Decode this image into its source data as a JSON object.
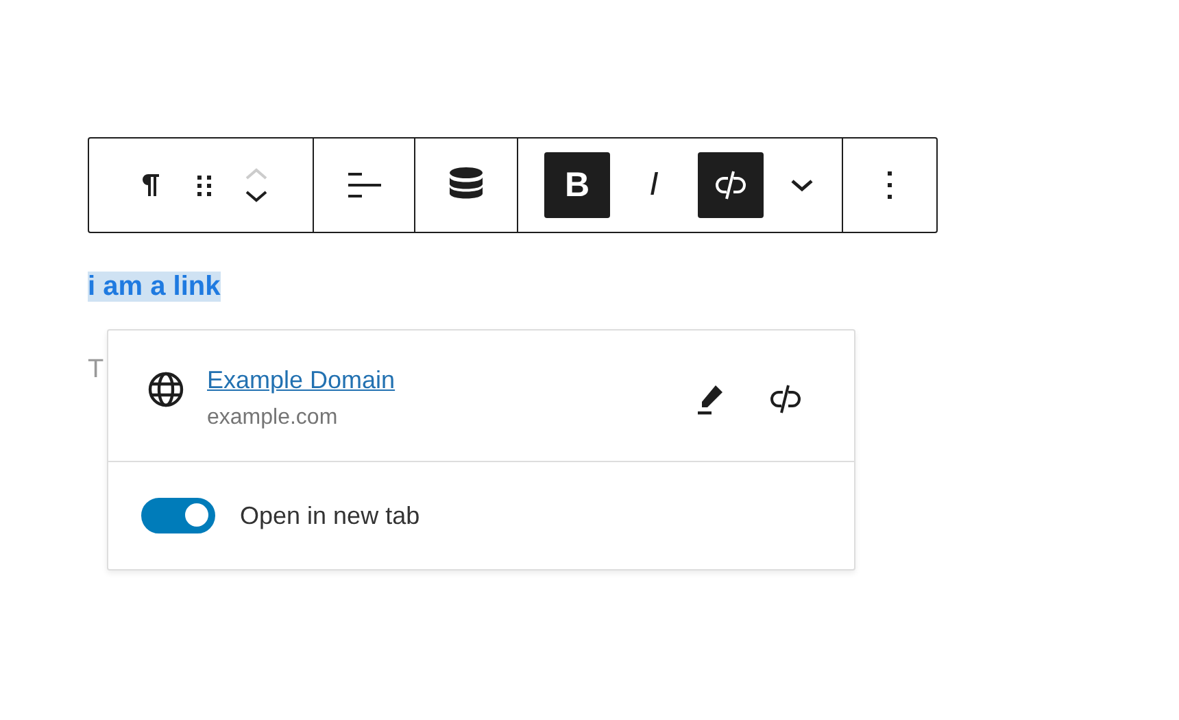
{
  "toolbar": {
    "bold": {
      "label": "B",
      "selected": true
    },
    "italic": {
      "label": "I",
      "selected": false
    },
    "unlink": {
      "selected": true
    }
  },
  "editor": {
    "selected_text": "i am a link",
    "placeholder": "T"
  },
  "link_popover": {
    "title": "Example Domain",
    "url": "example.com",
    "open_in_new_tab": {
      "label": "Open in new tab",
      "checked": true
    }
  }
}
